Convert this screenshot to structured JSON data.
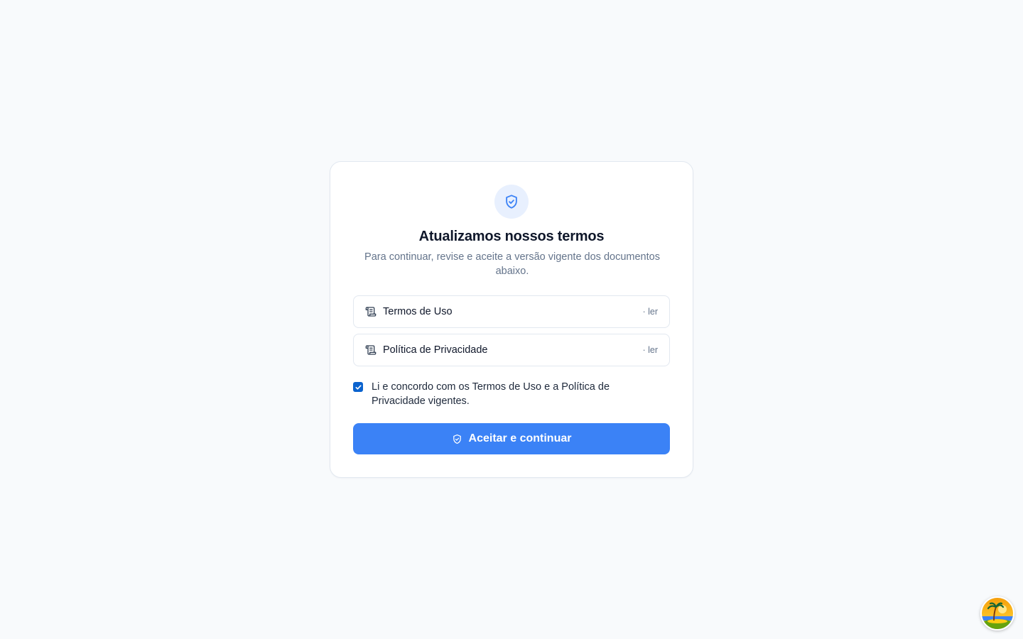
{
  "colors": {
    "background": "#f8fafc",
    "card_border": "#e2e8f0",
    "accent": "#3b82f6",
    "checkbox": "#0b63ce",
    "muted_text": "#64748b"
  },
  "dialog": {
    "icon": "shield-check-icon",
    "title": "Atualizamos nossos termos",
    "subtitle": "Para continuar, revise e aceite a versão vigente dos documentos abaixo.",
    "documents": [
      {
        "icon": "scroll-icon",
        "label": "Termos de Uso",
        "action": "· ler"
      },
      {
        "icon": "scroll-icon",
        "label": "Política de Privacidade",
        "action": "· ler"
      }
    ],
    "consent": {
      "checked": true,
      "label": "Li e concordo com os Termos de Uso e a Política de Privacidade vigentes."
    },
    "accept_button": {
      "icon": "shield-check-icon",
      "label": "Aceitar e continuar"
    }
  },
  "user_avatar": {
    "icon": "avatar-beach-icon"
  }
}
